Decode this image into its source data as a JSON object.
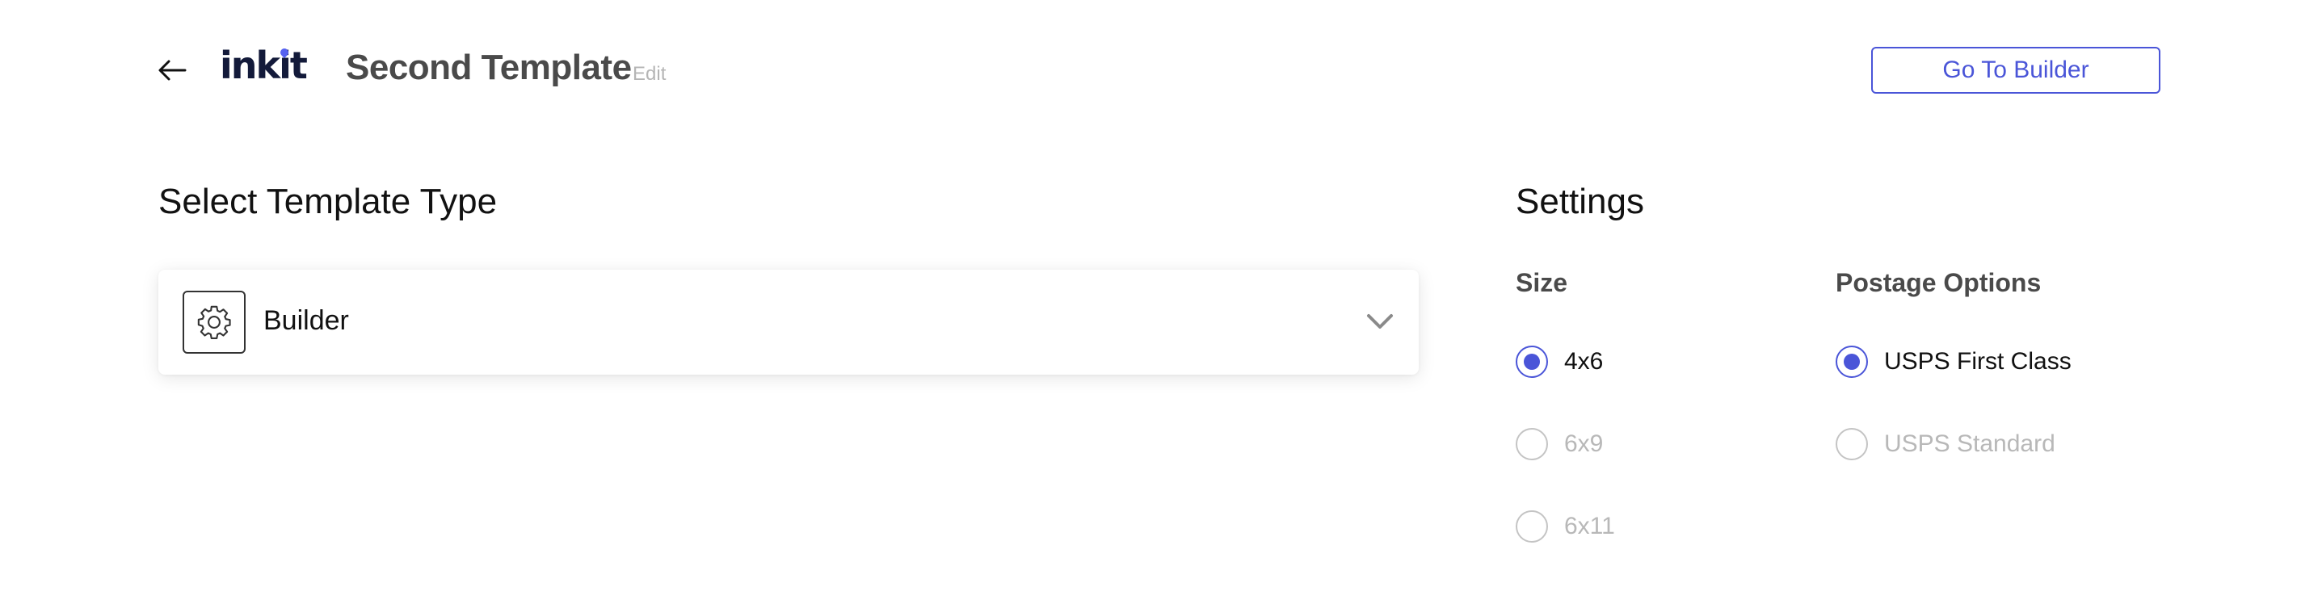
{
  "header": {
    "back_icon": "arrow-left-icon",
    "logo_text_pre": "ink",
    "logo_text_i": "i",
    "logo_text_post": "t",
    "brand_accent": "#5561f1",
    "title": "Second Template",
    "edit_label": "Edit",
    "builder_button_label": "Go To Builder"
  },
  "template_type": {
    "heading": "Select Template Type",
    "selected_label": "Builder",
    "selected_icon": "gear-icon",
    "dropdown_icon": "chevron-down-icon"
  },
  "settings": {
    "heading": "Settings",
    "size": {
      "label": "Size",
      "options": [
        {
          "label": "4x6",
          "checked": true
        },
        {
          "label": "6x9",
          "checked": false
        },
        {
          "label": "6x11",
          "checked": false
        }
      ]
    },
    "postage": {
      "label": "Postage Options",
      "options": [
        {
          "label": "USPS First Class",
          "checked": true
        },
        {
          "label": "USPS Standard",
          "checked": false
        }
      ]
    }
  },
  "colors": {
    "accent": "#4a55d8",
    "title_text": "#4a4a4a",
    "muted_text": "#b8b8b8"
  }
}
